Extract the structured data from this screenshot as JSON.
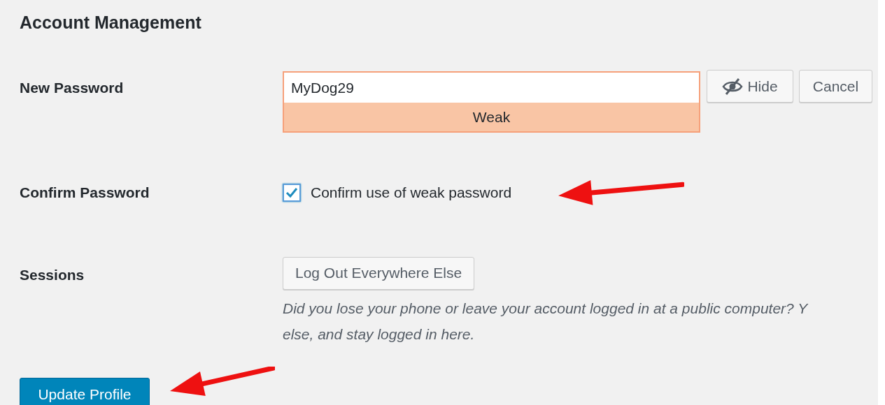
{
  "heading": "Account Management",
  "new_password": {
    "label": "New Password",
    "value": "MyDog29",
    "strength": "Weak",
    "hide_button": "Hide",
    "cancel_button": "Cancel"
  },
  "confirm_password": {
    "label": "Confirm Password",
    "checked": true,
    "checkbox_label": "Confirm use of weak password"
  },
  "sessions": {
    "label": "Sessions",
    "button": "Log Out Everywhere Else",
    "description_lines": [
      "Did you lose your phone or leave your account logged in at a public computer? Y",
      "else, and stay logged in here."
    ]
  },
  "submit_button": "Update Profile"
}
